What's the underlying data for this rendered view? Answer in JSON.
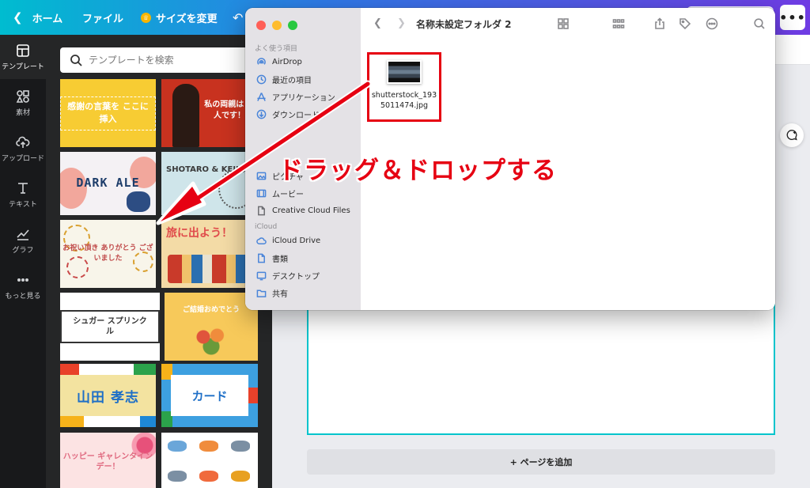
{
  "topbar": {
    "home_label": "ホーム",
    "file_label": "ファイル",
    "resize_label": "サイズを変更"
  },
  "rail": {
    "items": [
      {
        "label": "テンプレート",
        "icon": "template-icon"
      },
      {
        "label": "素材",
        "icon": "elements-icon"
      },
      {
        "label": "アップロード",
        "icon": "upload-icon"
      },
      {
        "label": "テキスト",
        "icon": "text-icon"
      },
      {
        "label": "グラフ",
        "icon": "chart-icon"
      },
      {
        "label": "もっと見る",
        "icon": "more-icon"
      }
    ]
  },
  "panel": {
    "search_placeholder": "テンプレートを検索",
    "templates": [
      {
        "text": "感謝の言葉を ここに挿入"
      },
      {
        "text": "私の両親は 超人です！"
      },
      {
        "text": "DARK ALE"
      },
      {
        "text": "SHOTARO & KEIKO"
      },
      {
        "text": "お祝い頂き ありがとう ございました"
      },
      {
        "text": "旅に出よう！"
      },
      {
        "text": "シュガー スプリンクル"
      },
      {
        "text": "ご結婚おめでとう"
      },
      {
        "text": "山田 孝志"
      },
      {
        "text": "カード"
      },
      {
        "text": "ハッピー ギャレンタイン デー！"
      },
      {
        "text": ""
      }
    ]
  },
  "editor": {
    "add_page_label": "+ ページを追加"
  },
  "finder": {
    "title": "名称未設定フォルダ 2",
    "favorites_header": "よく使う項目",
    "favorites": [
      {
        "label": "AirDrop",
        "icon": "airdrop-icon"
      },
      {
        "label": "最近の項目",
        "icon": "clock-icon"
      },
      {
        "label": "アプリケーション",
        "icon": "applications-icon"
      },
      {
        "label": "ダウンロード",
        "icon": "download-icon"
      },
      {
        "label": "ピクチャ",
        "icon": "pictures-icon"
      },
      {
        "label": "ムービー",
        "icon": "movies-icon"
      },
      {
        "label": "Creative Cloud Files",
        "icon": "document-icon"
      }
    ],
    "icloud_header": "iCloud",
    "icloud": [
      {
        "label": "iCloud Drive",
        "icon": "cloud-icon"
      },
      {
        "label": "書類",
        "icon": "document-icon"
      },
      {
        "label": "デスクトップ",
        "icon": "desktop-icon"
      },
      {
        "label": "共有",
        "icon": "shared-folder-icon"
      }
    ],
    "file": {
      "name": "shutterstock_1935011474.jpg"
    }
  },
  "annotation": {
    "text": "ドラッグ＆ドロップする",
    "color": "#e60012"
  },
  "colors": {
    "topbar_start": "#00bcd0",
    "topbar_end": "#6f3be3",
    "canvas_border": "#00c4cc",
    "finder_accent": "#4a85d9"
  }
}
